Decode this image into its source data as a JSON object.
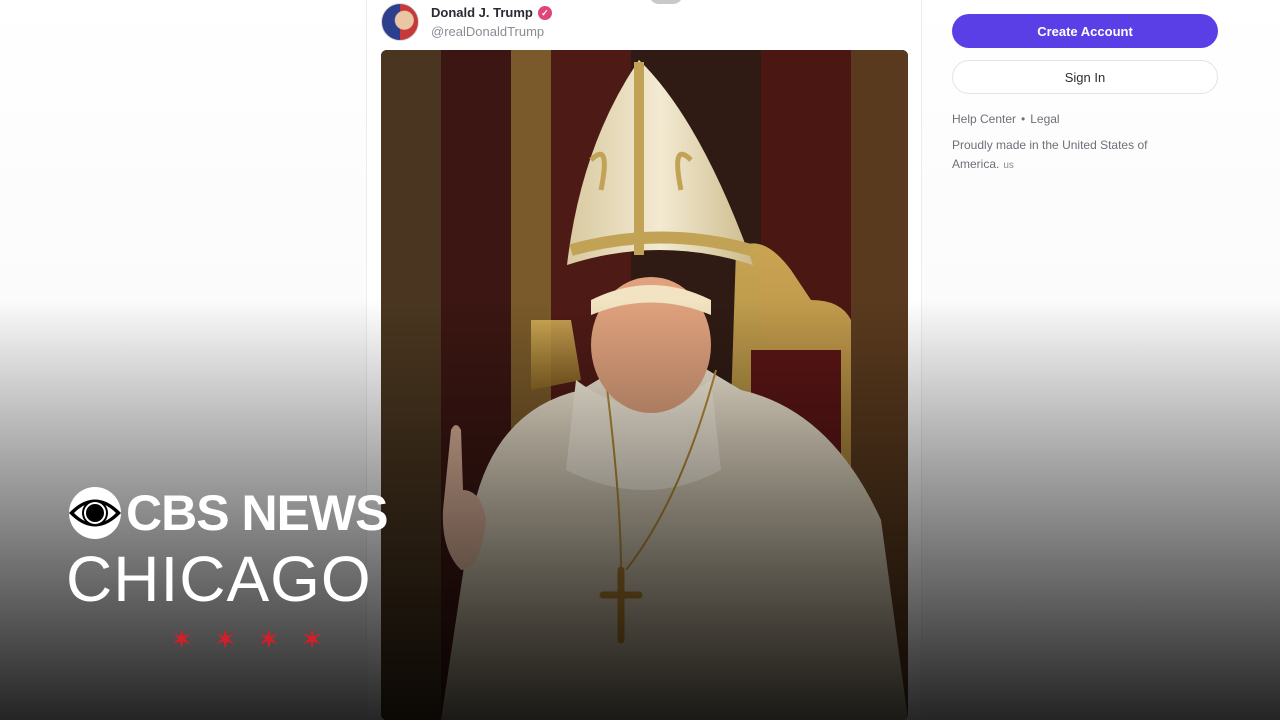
{
  "post": {
    "display_name": "Donald J. Trump",
    "handle": "@realDonaldTrump",
    "verified_icon": "verified-badge-icon",
    "image_icon": "post-image"
  },
  "sidebar": {
    "create_account_label": "Create Account",
    "sign_in_label": "Sign In",
    "help_center_label": "Help Center",
    "separator": "•",
    "legal_label": "Legal",
    "made_in_text": "Proudly made in the United States of America.",
    "made_in_flag": "us",
    "accent_color": "#5b3fe6"
  },
  "broadcast": {
    "network": "CBS NEWS",
    "station": "CHICAGO",
    "star_color": "#d21f2a",
    "stars": [
      "✶",
      "✶",
      "✶",
      "✶"
    ]
  }
}
